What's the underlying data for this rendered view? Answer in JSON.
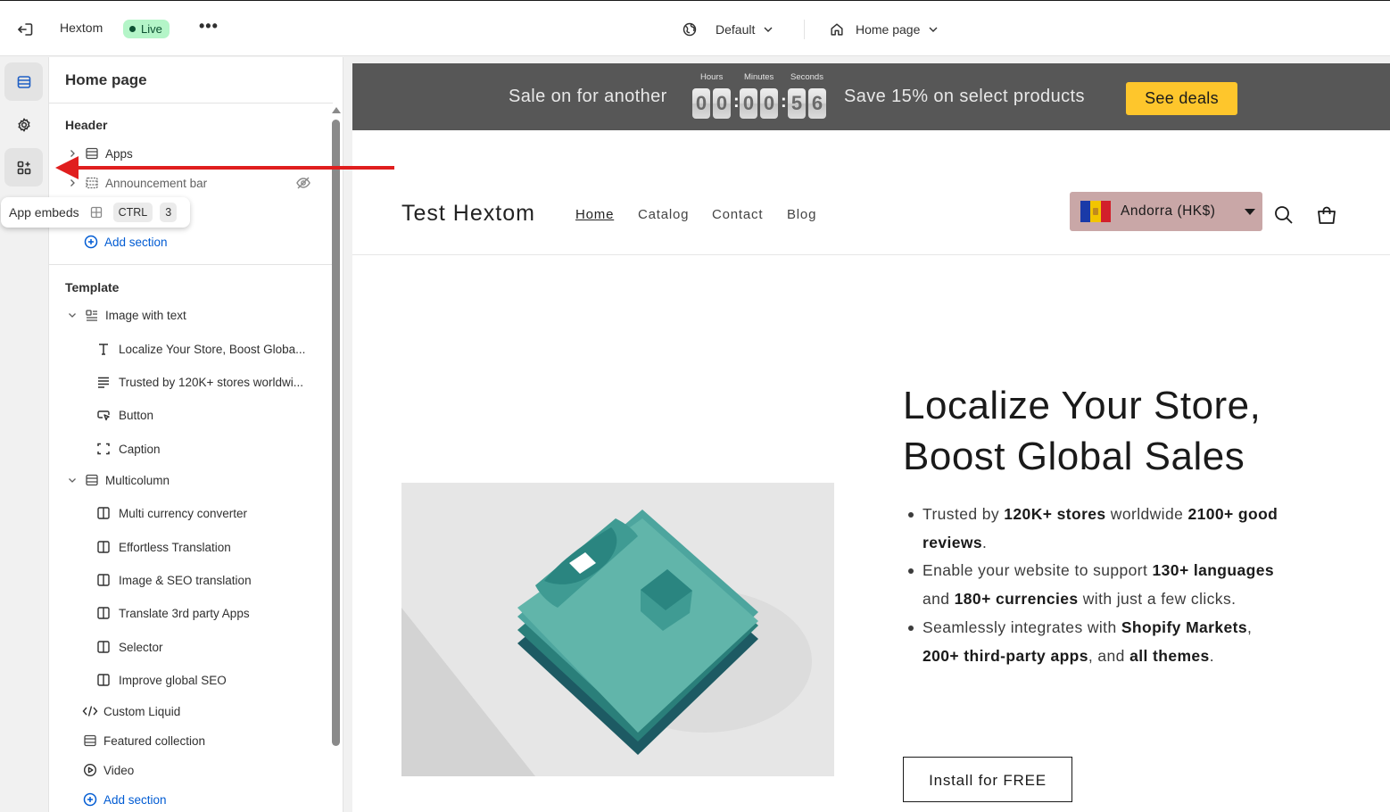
{
  "topbar": {
    "store_name": "Hextom",
    "status": "Live",
    "more": "•••",
    "theme": "Default",
    "page": "Home page"
  },
  "rail": {
    "items": [
      {
        "name": "sections-icon",
        "active": true
      },
      {
        "name": "settings-icon",
        "active": false
      },
      {
        "name": "app-embeds-icon",
        "active": false
      }
    ]
  },
  "tooltip": {
    "label": "App embeds",
    "key1": "CTRL",
    "key2": "3"
  },
  "panel": {
    "title": "Home page",
    "header_section": {
      "title": "Header",
      "items": [
        {
          "label": "Apps",
          "icon": "layout-icon"
        },
        {
          "label": "Announcement bar",
          "icon": "layout-icon",
          "hidden": true
        }
      ],
      "add_section": "Add section"
    },
    "template_section": {
      "title": "Template",
      "image_with_text": {
        "label": "Image with text",
        "children": [
          {
            "label": "Localize Your Store, Boost Globa...",
            "icon": "heading-icon"
          },
          {
            "label": "Trusted by 120K+ stores worldwi...",
            "icon": "text-icon"
          },
          {
            "label": "Button",
            "icon": "button-icon"
          },
          {
            "label": "Caption",
            "icon": "caption-icon"
          }
        ]
      },
      "multicolumn": {
        "label": "Multicolumn",
        "children": [
          {
            "label": "Multi currency converter"
          },
          {
            "label": "Effortless Translation"
          },
          {
            "label": "Image & SEO translation"
          },
          {
            "label": "Translate 3rd party Apps"
          },
          {
            "label": "Selector"
          },
          {
            "label": "Improve global SEO"
          }
        ]
      },
      "others": [
        {
          "label": "Custom Liquid",
          "icon": "code-icon"
        },
        {
          "label": "Featured collection",
          "icon": "layout-icon"
        },
        {
          "label": "Video",
          "icon": "play-icon"
        }
      ],
      "add_section": "Add section"
    }
  },
  "preview": {
    "announcement": {
      "text1": "Sale on for another",
      "labels": {
        "hours": "Hours",
        "minutes": "Minutes",
        "seconds": "Seconds"
      },
      "digits": [
        "0",
        "0",
        "0",
        "0",
        "5",
        "6"
      ],
      "text2": "Save 15% on select products",
      "button": "See deals",
      "button_color": "#fec62c",
      "bar_color": "#575757"
    },
    "header": {
      "brand": "Test Hextom",
      "nav": [
        "Home",
        "Catalog",
        "Contact",
        "Blog"
      ],
      "currency": "Andorra (HK$)"
    },
    "hero": {
      "title_line1": "Localize Your Store,",
      "title_line2": "Boost Global Sales",
      "bullets": [
        {
          "parts": [
            "Trusted by ",
            "120K+ stores",
            " worldwide ",
            "2100+ good reviews",
            "."
          ]
        },
        {
          "parts": [
            "Enable your website to support ",
            "130+ languages",
            " and ",
            "180+ currencies",
            " with just a few clicks."
          ]
        },
        {
          "parts": [
            "Seamlessly integrates with ",
            "Shopify Markets",
            ", ",
            "200+ third-party apps",
            ", and ",
            "all themes",
            "."
          ]
        }
      ],
      "button": "Install for FREE"
    }
  },
  "annotation_arrow_color": "#e01e1e"
}
